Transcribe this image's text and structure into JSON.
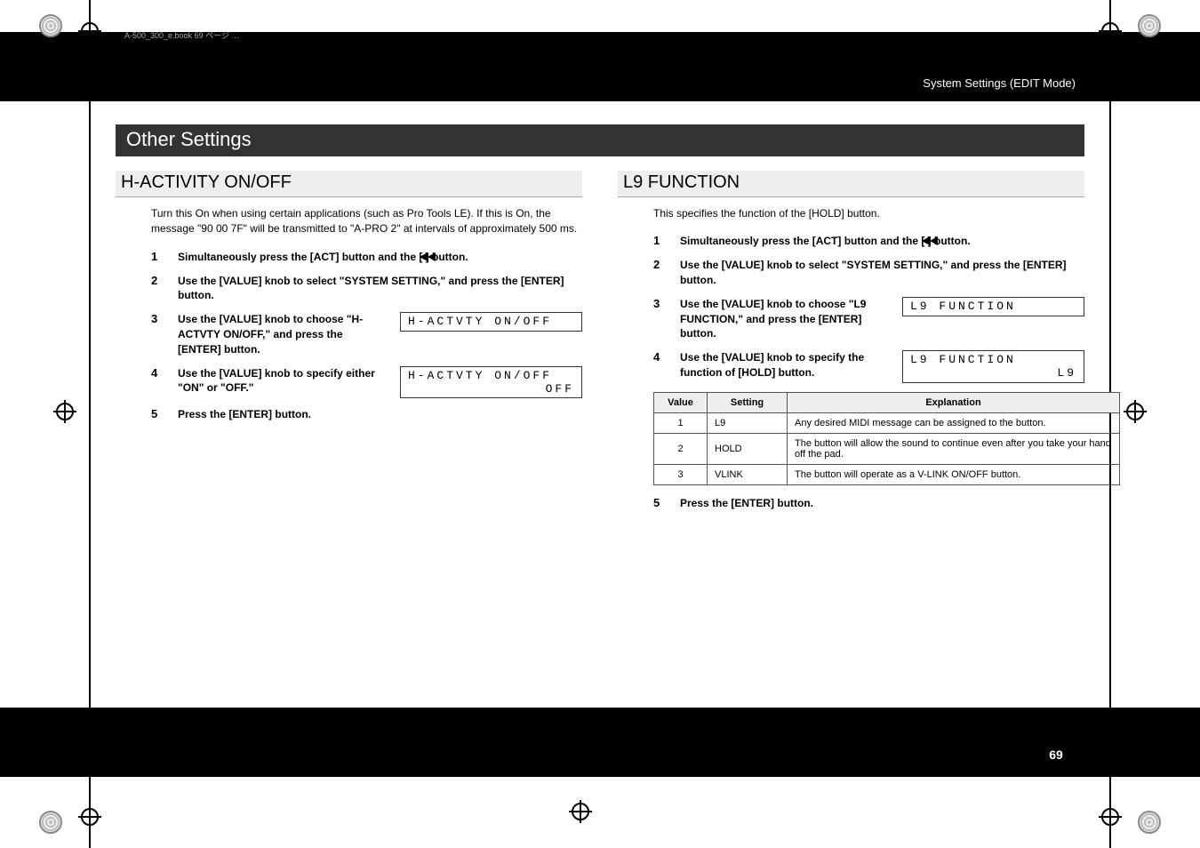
{
  "header": {
    "breadcrumb": "System Settings (EDIT Mode)",
    "slug": "A-500_300_e.book  69 ページ  …"
  },
  "section_title": "Other Settings",
  "left": {
    "heading": "H-ACTIVITY ON/OFF",
    "intro": "Turn this On when using certain applications (such as Pro Tools LE). If this is On, the message \"90 00 7F\" will be transmitted to \"A-PRO 2\" at intervals of approximately 500 ms.",
    "step1": "Simultaneously press the [ACT] button and the [        ] button.",
    "step2": "Use the [VALUE] knob to select \"SYSTEM SETTING,\" and press the [ENTER] button.",
    "step3": "Use the [VALUE] knob to choose \"H-ACTVTY ON/OFF,\" and press the [ENTER] button.",
    "step4": "Use the [VALUE] knob to specify either \"ON\" or \"OFF.\"",
    "step5": "Press the [ENTER] button.",
    "lcd1": "H-ACTVTY ON/OFF",
    "lcd2_line1": "H-ACTVTY ON/OFF",
    "lcd2_line2": "OFF"
  },
  "right": {
    "heading": "L9 FUNCTION",
    "intro": "This specifies the function of the [HOLD] button.",
    "step1": "Simultaneously press the [ACT] button and the [        ] button.",
    "step2": "Use the [VALUE] knob to select \"SYSTEM SETTING,\" and press the [ENTER] button.",
    "step3": "Use the [VALUE] knob to choose \"L9 FUNCTION,\" and press the [ENTER] button.",
    "step4": "Use the [VALUE] knob to specify the function of [HOLD] button.",
    "step5": "Press the [ENTER] button.",
    "lcd1": "L9 FUNCTION",
    "lcd2_line1": "L9 FUNCTION",
    "lcd2_line2": "L9"
  },
  "table": {
    "headers": {
      "value": "Value",
      "setting": "Setting",
      "explanation": "Explanation"
    },
    "rows": [
      {
        "value": "1",
        "setting": "L9",
        "explanation": "Any desired MIDI message can be assigned to the button."
      },
      {
        "value": "2",
        "setting": "HOLD",
        "explanation": "The button will allow the sound to continue even after you take your hand off the pad."
      },
      {
        "value": "3",
        "setting": "VLINK",
        "explanation": "The button will operate as a V-LINK ON/OFF button."
      }
    ]
  },
  "page_number": "69"
}
